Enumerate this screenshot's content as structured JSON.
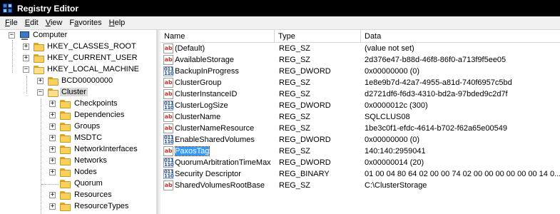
{
  "window": {
    "title": "Registry Editor"
  },
  "menu": [
    {
      "pre": "",
      "u": "F",
      "post": "ile"
    },
    {
      "pre": "",
      "u": "E",
      "post": "dit"
    },
    {
      "pre": "",
      "u": "V",
      "post": "iew"
    },
    {
      "pre": "F",
      "u": "a",
      "post": "vorites"
    },
    {
      "pre": "",
      "u": "H",
      "post": "elp"
    }
  ],
  "tree": {
    "computer": "Computer",
    "hkcr": "HKEY_CLASSES_ROOT",
    "hkcu": "HKEY_CURRENT_USER",
    "hklm": "HKEY_LOCAL_MACHINE",
    "bcd": "BCD00000000",
    "cluster": "Cluster",
    "children": [
      "Checkpoints",
      "Dependencies",
      "Groups",
      "MSDTC",
      "NetworkInterfaces",
      "Networks",
      "Nodes",
      "Quorum",
      "Resources",
      "ResourceTypes"
    ]
  },
  "columns": {
    "name": "Name",
    "type": "Type",
    "data": "Data"
  },
  "values": [
    {
      "icon": "string-value-icon",
      "name": "(Default)",
      "type": "REG_SZ",
      "data": "(value not set)"
    },
    {
      "icon": "string-value-icon",
      "name": "AvailableStorage",
      "type": "REG_SZ",
      "data": "2d376e47-b88d-46f8-86f0-a713f9f5ee05"
    },
    {
      "icon": "binary-value-icon",
      "name": "BackupInProgress",
      "type": "REG_DWORD",
      "data": "0x00000000 (0)"
    },
    {
      "icon": "string-value-icon",
      "name": "ClusterGroup",
      "type": "REG_SZ",
      "data": "1e8e9b7d-42a7-4955-a81d-740f6957c5bd"
    },
    {
      "icon": "string-value-icon",
      "name": "ClusterInstanceID",
      "type": "REG_SZ",
      "data": "d2721df6-f6d3-4310-bd2a-97bded9c2d7f"
    },
    {
      "icon": "binary-value-icon",
      "name": "ClusterLogSize",
      "type": "REG_DWORD",
      "data": "0x0000012c (300)"
    },
    {
      "icon": "string-value-icon",
      "name": "ClusterName",
      "type": "REG_SZ",
      "data": "SQLCLUS08"
    },
    {
      "icon": "string-value-icon",
      "name": "ClusterNameResource",
      "type": "REG_SZ",
      "data": "1be3c0f1-efdc-4614-b702-f62a65e00549"
    },
    {
      "icon": "binary-value-icon",
      "name": "EnableSharedVolumes",
      "type": "REG_DWORD",
      "data": "0x00000000 (0)"
    },
    {
      "icon": "string-value-icon",
      "name": "PaxosTag",
      "type": "REG_SZ",
      "data": "140:140:2959041",
      "selected": true
    },
    {
      "icon": "binary-value-icon",
      "name": "QuorumArbitrationTimeMax",
      "type": "REG_DWORD",
      "data": "0x00000014 (20)"
    },
    {
      "icon": "binary-value-icon",
      "name": "Security Descriptor",
      "type": "REG_BINARY",
      "data": "01 00 04 80 64 02 00 00 74 02 00 00 00 00 00 00 14 0..."
    },
    {
      "icon": "string-value-icon",
      "name": "SharedVolumesRootBase",
      "type": "REG_SZ",
      "data": "C:\\ClusterStorage"
    }
  ]
}
